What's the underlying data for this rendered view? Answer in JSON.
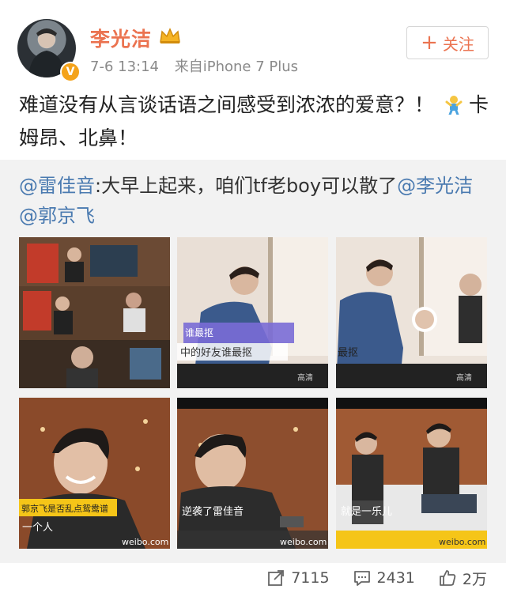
{
  "post": {
    "user": {
      "name": "李光洁"
    },
    "meta": {
      "time": "7-6 13:14",
      "source": "来自iPhone 7 Plus"
    },
    "follow_label": "关注",
    "text_main": "难道没有从言谈话语之间感受到浓浓的爱意？！",
    "text_tail": "卡姆昂、北鼻！"
  },
  "repost": {
    "author": "@雷佳音",
    "colon": ":",
    "body": "大早上起来，咱们tf老boy可以散了",
    "mention_1": "@李光洁",
    "mention_2": "@郭京飞",
    "images": [
      {
        "caption": "",
        "watermark": ""
      },
      {
        "caption": "中的好友谁最抠",
        "watermark": ""
      },
      {
        "caption": "最抠",
        "watermark": ""
      },
      {
        "caption": "一个人",
        "watermark": "weibo.com"
      },
      {
        "caption": "逆袭了雷佳音",
        "watermark": "weibo.com"
      },
      {
        "caption": "就是一乐儿",
        "watermark": "weibo.com"
      }
    ]
  },
  "actions": {
    "repost_count": "7115",
    "comment_count": "2431",
    "like_count": "2万"
  },
  "colors": {
    "accent": "#eb7350",
    "link": "#4a7ab0",
    "repost_bg": "#f2f2f2"
  }
}
